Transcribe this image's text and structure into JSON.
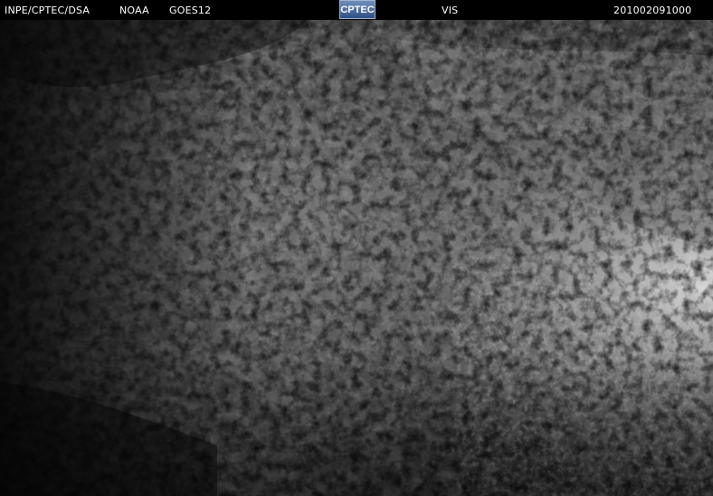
{
  "header": {
    "source": "INPE/CPTEC/DSA",
    "agency": "NOAA",
    "satellite": "GOES12",
    "logo_text": "CPTEC",
    "channel": "VIS",
    "timestamp": "201002091000"
  },
  "imagery": {
    "colors": {
      "header_background": "#000000",
      "header_text": "#ffffff",
      "cloud_base": "#6e6e6e",
      "bright_cloud": "#e2e2e2",
      "dark_surface": "#141414"
    }
  }
}
